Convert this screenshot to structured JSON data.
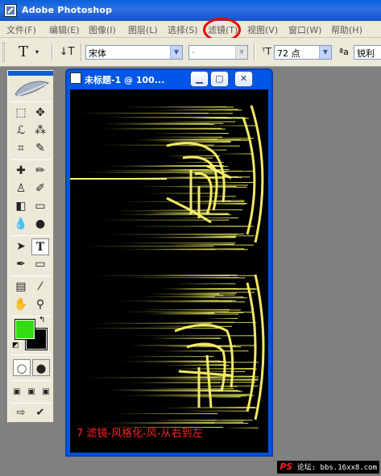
{
  "window": {
    "title": "Adobe Photoshop"
  },
  "menu": {
    "items": [
      "文件(F)",
      "编辑(E)",
      "图像(I)",
      "图层(L)",
      "选择(S)",
      "滤镜(T)",
      "视图(V)",
      "窗口(W)",
      "帮助(H)"
    ],
    "highlighted": "滤镜(T)"
  },
  "options": {
    "font_family": "宋体",
    "font_style": "-",
    "font_size": "72 点",
    "antialias_icon_text": "ªa",
    "antialias_value": "锐利"
  },
  "document": {
    "title": "未标题-1 @ 100...",
    "caption": "7   滤镜-风格化-风-从右到左",
    "canvas_bg": "#000000",
    "effect_color": "#ffff66"
  },
  "colors": {
    "foreground": "#33dd11",
    "background": "#000000"
  },
  "watermark": {
    "brand": "PS",
    "text": "论坛: bbs.16xx8.com"
  }
}
